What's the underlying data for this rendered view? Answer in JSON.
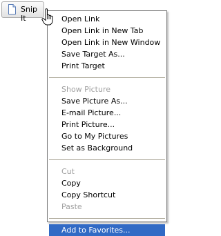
{
  "snip_button": {
    "label": "Snip It",
    "icon": "document-icon"
  },
  "cursor": {
    "icon": "hand-pointer-icon"
  },
  "menu": {
    "groups": [
      [
        {
          "label": "Open Link",
          "enabled": true
        },
        {
          "label": "Open Link in New Tab",
          "enabled": true
        },
        {
          "label": "Open Link in New Window",
          "enabled": true
        },
        {
          "label": "Save Target As...",
          "enabled": true
        },
        {
          "label": "Print Target",
          "enabled": true
        }
      ],
      [
        {
          "label": "Show Picture",
          "enabled": false
        },
        {
          "label": "Save Picture As...",
          "enabled": true
        },
        {
          "label": "E-mail Picture...",
          "enabled": true
        },
        {
          "label": "Print Picture...",
          "enabled": true
        },
        {
          "label": "Go to My Pictures",
          "enabled": true
        },
        {
          "label": "Set as Background",
          "enabled": true
        }
      ],
      [
        {
          "label": "Cut",
          "enabled": false
        },
        {
          "label": "Copy",
          "enabled": true
        },
        {
          "label": "Copy Shortcut",
          "enabled": true
        },
        {
          "label": "Paste",
          "enabled": false
        }
      ],
      [
        {
          "label": "Add to Favorites...",
          "enabled": true,
          "selected": true
        }
      ]
    ]
  },
  "colors": {
    "selection": "#316ac5",
    "disabled_text": "#a0a0a0",
    "menu_border": "#7b7b7b",
    "separator": "#aca899"
  }
}
